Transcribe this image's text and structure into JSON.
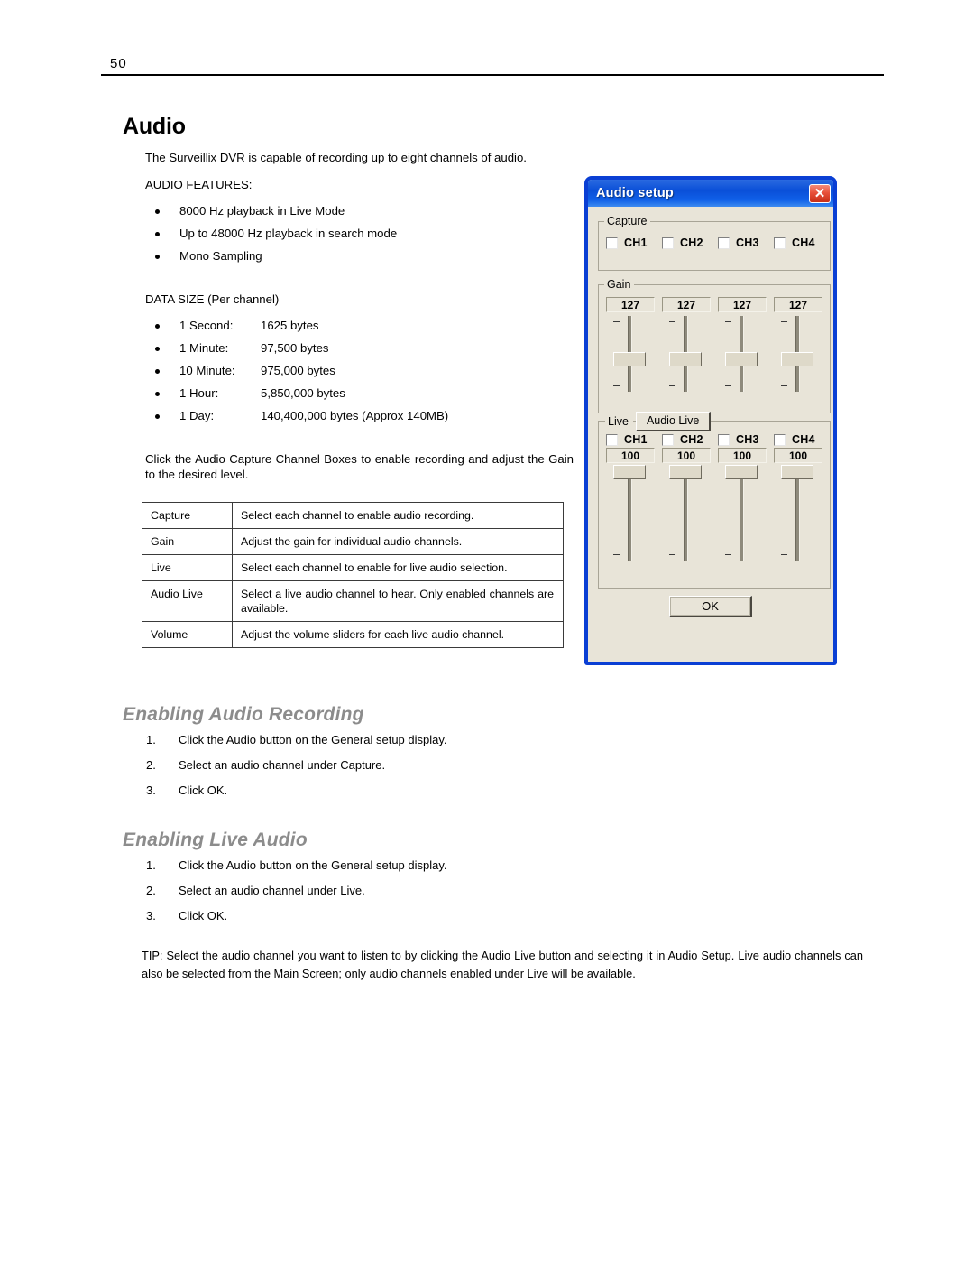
{
  "page": {
    "number": "50"
  },
  "section": {
    "title": "Audio",
    "intro": "The Surveillix DVR is capable of recording up to eight channels of audio.",
    "features_label": "AUDIO FEATURES:",
    "features": [
      "8000 Hz playback in Live Mode",
      "Up to 48000 Hz playback in search mode",
      "Mono Sampling"
    ],
    "data_size_label": "DATA SIZE (Per channel)",
    "data_size": [
      {
        "term": "1 Second:",
        "value": "1625 bytes"
      },
      {
        "term": "1 Minute:",
        "value": "97,500 bytes"
      },
      {
        "term": "10 Minute:",
        "value": "975,000 bytes"
      },
      {
        "term": "1 Hour:",
        "value": "5,850,000 bytes"
      },
      {
        "term": "1 Day:",
        "value": "140,400,000 bytes (Approx 140MB)"
      }
    ],
    "instruction": "Click the Audio Capture Channel Boxes to enable recording and adjust the Gain to the desired level."
  },
  "table": {
    "rows": [
      {
        "term": "Capture",
        "desc": "Select each channel to enable audio recording."
      },
      {
        "term": "Gain",
        "desc": "Adjust the gain for individual audio channels."
      },
      {
        "term": "Live",
        "desc": "Select each channel to enable for live audio selection."
      },
      {
        "term": "Audio Live",
        "desc": "Select a live audio channel to hear.  Only enabled channels are available."
      },
      {
        "term": "Volume",
        "desc": "Adjust the volume sliders for each live audio channel."
      }
    ]
  },
  "enabling_audio_recording": {
    "heading": "Enabling Audio Recording",
    "steps": [
      {
        "num": "1.",
        "text": "Click the Audio button on the General setup display."
      },
      {
        "num": "2.",
        "text": "Select an audio channel under Capture."
      },
      {
        "num": "3.",
        "text": "Click OK."
      }
    ]
  },
  "enabling_live_audio": {
    "heading": "Enabling Live Audio",
    "steps": [
      {
        "num": "1.",
        "text": "Click the Audio button on the General setup display."
      },
      {
        "num": "2.",
        "text": "Select an audio channel under Live."
      },
      {
        "num": "3.",
        "text": "Click OK."
      }
    ]
  },
  "tip": "TIP: Select the audio channel you want to listen to by clicking the Audio Live button and selecting it in Audio Setup.  Live audio channels can also be selected from the Main Screen; only audio channels enabled under Live will be available.",
  "dialog": {
    "title": "Audio setup",
    "close_icon": "✕",
    "capture": {
      "legend": "Capture",
      "channels": [
        {
          "label": "CH1",
          "checked": false
        },
        {
          "label": "CH2",
          "checked": false
        },
        {
          "label": "CH3",
          "checked": false
        },
        {
          "label": "CH4",
          "checked": false
        }
      ]
    },
    "gain": {
      "legend": "Gain",
      "values": [
        "127",
        "127",
        "127",
        "127"
      ]
    },
    "live": {
      "legend": "Live",
      "audio_live_button": "Audio Live",
      "channels": [
        {
          "label": "CH1",
          "checked": false
        },
        {
          "label": "CH2",
          "checked": false
        },
        {
          "label": "CH3",
          "checked": false
        },
        {
          "label": "CH4",
          "checked": false
        }
      ],
      "values": [
        "100",
        "100",
        "100",
        "100"
      ]
    },
    "ok_label": "OK",
    "colors": {
      "titlebar_blue": "#0a4fd8",
      "close_red": "#c72e17",
      "face": "#e8e4d8",
      "border_blue": "#0a3fd4"
    }
  }
}
